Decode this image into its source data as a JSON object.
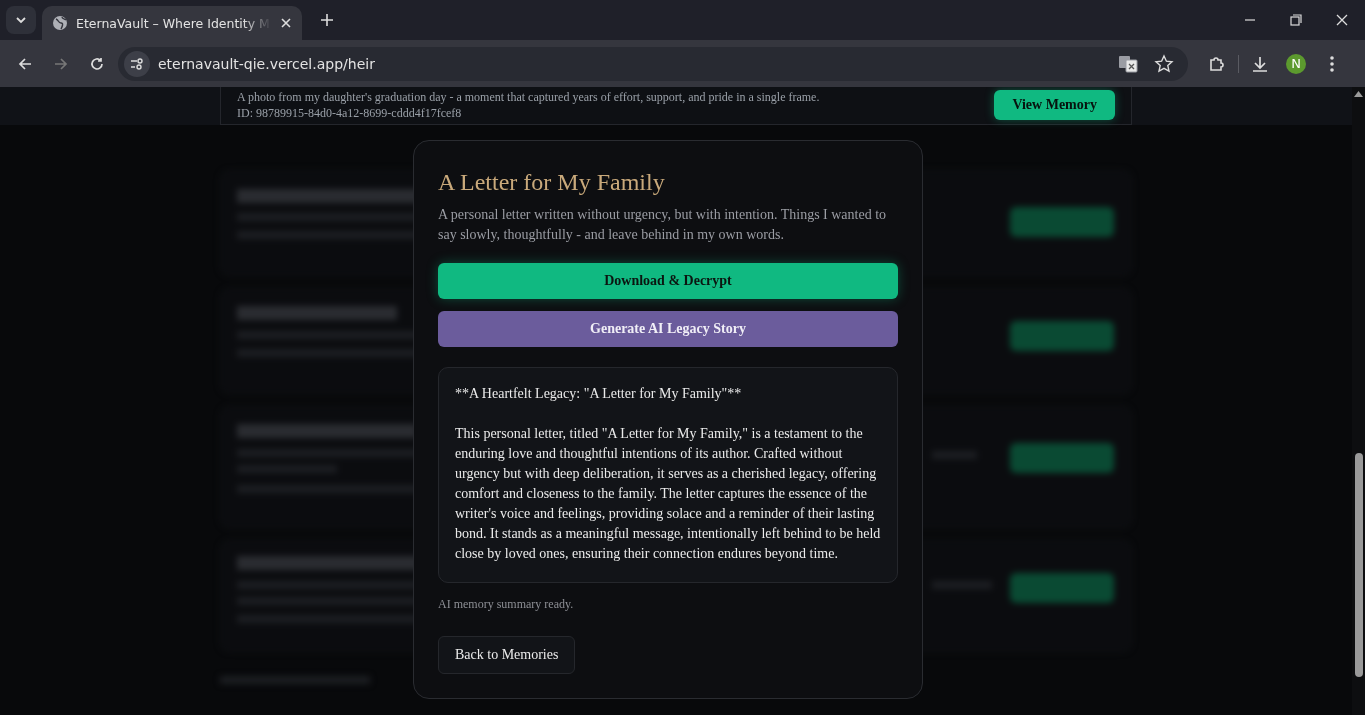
{
  "browser": {
    "tab_title": "EternaVault – Where Identity M",
    "url": "eternavault-qie.vercel.app/heir",
    "profile_initial": "N"
  },
  "background_card": {
    "description": "A photo from my daughter's graduation day - a moment that captured years of effort, support, and pride in a single frame.",
    "id": "ID: 98789915-84d0-4a12-8699-cddd4f17fcef8",
    "button": "View Memory"
  },
  "modal": {
    "title": "A Letter for My Family",
    "description": "A personal letter written without urgency, but with intention. Things I wanted to say slowly, thoughtfully - and leave behind in my own words.",
    "buttons": [
      {
        "label": "Download & Decrypt",
        "kind": "primary"
      },
      {
        "label": "Generate AI Legacy Story",
        "kind": "secondary"
      }
    ],
    "summary": {
      "heading": "**A Heartfelt Legacy: \"A Letter for My Family\"**",
      "body": "This personal letter, titled \"A Letter for My Family,\" is a testament to the enduring love and thoughtful intentions of its author. Crafted without urgency but with deep deliberation, it serves as a cherished legacy, offering comfort and closeness to the family. The letter captures the essence of the writer's voice and feelings, providing solace and a reminder of their lasting bond. It stands as a meaningful message, intentionally left behind to be held close by loved ones, ensuring their connection endures beyond time."
    },
    "status": "AI memory summary ready.",
    "back_button": "Back to Memories"
  }
}
